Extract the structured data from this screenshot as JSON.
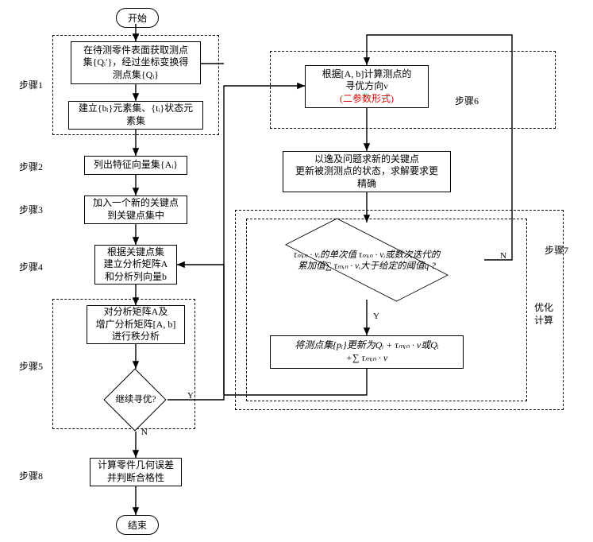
{
  "terminal": {
    "start": "开始",
    "end": "结束"
  },
  "steps": {
    "label1": "步骤1",
    "box1a_l1": "在待测零件表面获取测点",
    "box1a_l2": "集{Qᵢ′}，经过坐标变换得",
    "box1a_l3": "测点集{Qᵢ}",
    "box1b_l1": "建立{bᵢ}元素集、{tᵢ}状态元",
    "box1b_l2": "素集",
    "label2": "步骤2",
    "box2": "列出特征向量集{Aᵢ}",
    "label3": "步骤3",
    "box3_l1": "加入一个新的关键点",
    "box3_l2": "到关键点集中",
    "label4": "步骤4",
    "box4_l1": "根据关键点集",
    "box4_l2": "建立分析矩阵A",
    "box4_l3": "和分析列向量b",
    "label5": "步骤5",
    "box5_l1": "对分析矩阵A及",
    "box5_l2": "增广分析矩阵[A, b]",
    "box5_l3": "进行秩分析",
    "diamond5": "继续寻优?",
    "label6": "步骤6",
    "box6_l1": "根据[A, b]计算测点的",
    "box6_l2": "寻优方向ν",
    "box6_l3": "(二参数形式)",
    "box_between_l1": "以逸及问题求新的关键点",
    "box_between_l2": "更新被测测点的状态，求解要求更",
    "box_between_l3": "精确",
    "label7": "步骤7",
    "label7_sub_l1": "优化",
    "label7_sub_l2": "计算",
    "diamond7_l1": "τₘᵢₙ · νᵢ的单次值 τₘᵢₙ · νᵢ或数次迭代的",
    "diamond7_l2": "累加值∑ τₘᵢₙ · νᵢ大于给定的阈值q ?",
    "box7_l1": "将测点集{pᵢ}更新为Qᵢ + τₘᵢₙ · ν或Qᵢ",
    "box7_l2": "+∑ τₘᵢₙ · ν",
    "label8": "步骤8",
    "box8_l1": "计算零件几何误差",
    "box8_l2": "并判断合格性"
  },
  "yn": {
    "y": "Y",
    "n": "N"
  }
}
